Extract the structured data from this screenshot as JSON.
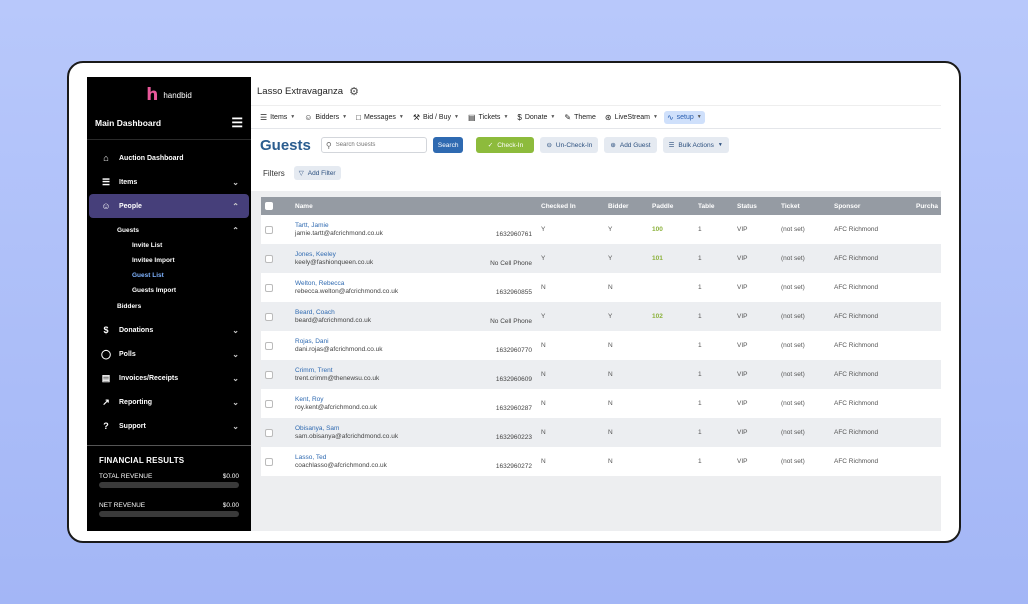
{
  "brand": {
    "name": "handbid",
    "logo_glyph": "h",
    "logo_color": "#e8589a"
  },
  "sidebar": {
    "title": "Main Dashboard",
    "items": [
      {
        "label": "Auction Dashboard",
        "icon": "home-icon"
      },
      {
        "label": "Items",
        "icon": "layers-icon"
      },
      {
        "label": "People",
        "icon": "users-icon"
      },
      {
        "label": "Donations",
        "icon": "dollar-icon"
      },
      {
        "label": "Polls",
        "icon": "chat-icon"
      },
      {
        "label": "Invoices/Receipts",
        "icon": "document-icon"
      },
      {
        "label": "Reporting",
        "icon": "chart-icon"
      },
      {
        "label": "Support",
        "icon": "help-icon"
      }
    ],
    "people_sub": {
      "guests": "Guests",
      "children": [
        "Invite List",
        "Invitee Import",
        "Guest List",
        "Guests Import"
      ],
      "bidders": "Bidders"
    },
    "financial": {
      "title": "FINANCIAL RESULTS",
      "total_label": "TOTAL REVENUE",
      "total_value": "$0.00",
      "net_label": "NET REVENUE",
      "net_value": "$0.00"
    }
  },
  "header": {
    "event_title": "Lasso Extravaganza"
  },
  "topnav": [
    "Items",
    "Bidders",
    "Messages",
    "Bid / Buy",
    "Tickets",
    "Donate",
    "Theme",
    "LiveStream",
    "setup"
  ],
  "toolbar": {
    "page_title": "Guests",
    "search_placeholder": "Search Guests",
    "search_button": "Search",
    "checkin": "Check-In",
    "uncheckin": "Un-Check-In",
    "add_guest": "Add Guest",
    "bulk_actions": "Bulk Actions"
  },
  "filters": {
    "label": "Filters",
    "add_filter": "Add Filter"
  },
  "table": {
    "columns": [
      "Name",
      "Checked In",
      "Bidder",
      "Paddle",
      "Table",
      "Status",
      "Ticket",
      "Sponsor",
      "Purcha"
    ],
    "rows": [
      {
        "name": "Tartt, Jamie",
        "email": "jamie.tartt@afcrichmond.co.uk",
        "phone": "1632960761",
        "checked_in": "Y",
        "bidder": "Y",
        "paddle": "100",
        "table": "1",
        "status": "VIP",
        "ticket": "(not set)",
        "sponsor": "AFC Richmond"
      },
      {
        "name": "Jones, Keeley",
        "email": "keely@fashionqueen.co.uk",
        "phone": "No Cell Phone",
        "checked_in": "Y",
        "bidder": "Y",
        "paddle": "101",
        "table": "1",
        "status": "VIP",
        "ticket": "(not set)",
        "sponsor": "AFC Richmond"
      },
      {
        "name": "Welton, Rebecca",
        "email": "rebecca.welton@afcrichmond.co.uk",
        "phone": "1632960855",
        "checked_in": "N",
        "bidder": "N",
        "paddle": "",
        "table": "1",
        "status": "VIP",
        "ticket": "(not set)",
        "sponsor": "AFC Richmond"
      },
      {
        "name": "Beard, Coach",
        "email": "beard@afcrichmond.co.uk",
        "phone": "No Cell Phone",
        "checked_in": "Y",
        "bidder": "Y",
        "paddle": "102",
        "table": "1",
        "status": "VIP",
        "ticket": "(not set)",
        "sponsor": "AFC Richmond"
      },
      {
        "name": "Rojas, Dani",
        "email": "dani.rojas@afcrichmond.co.uk",
        "phone": "1632960770",
        "checked_in": "N",
        "bidder": "N",
        "paddle": "",
        "table": "1",
        "status": "VIP",
        "ticket": "(not set)",
        "sponsor": "AFC Richmond"
      },
      {
        "name": "Crimm, Trent",
        "email": "trent.crimm@thenewsu.co.uk",
        "phone": "1632960609",
        "checked_in": "N",
        "bidder": "N",
        "paddle": "",
        "table": "1",
        "status": "VIP",
        "ticket": "(not set)",
        "sponsor": "AFC Richmond"
      },
      {
        "name": "Kent, Roy",
        "email": "roy.kent@afcrichmond.co.uk",
        "phone": "1632960287",
        "checked_in": "N",
        "bidder": "N",
        "paddle": "",
        "table": "1",
        "status": "VIP",
        "ticket": "(not set)",
        "sponsor": "AFC Richmond"
      },
      {
        "name": "Obisanya, Sam",
        "email": "sam.obisanya@afcrichdmond.co.uk",
        "phone": "1632960223",
        "checked_in": "N",
        "bidder": "N",
        "paddle": "",
        "table": "1",
        "status": "VIP",
        "ticket": "(not set)",
        "sponsor": "AFC Richmond"
      },
      {
        "name": "Lasso, Ted",
        "email": "coachlasso@afcrichmond.co.uk",
        "phone": "1632960272",
        "checked_in": "N",
        "bidder": "N",
        "paddle": "",
        "table": "1",
        "status": "VIP",
        "ticket": "(not set)",
        "sponsor": "AFC Richmond"
      }
    ]
  },
  "colors": {
    "accent": "#2f6ab1",
    "checkin": "#8dbb3c",
    "sidebar_active": "#463f7a",
    "background": "#b0c1f9"
  }
}
